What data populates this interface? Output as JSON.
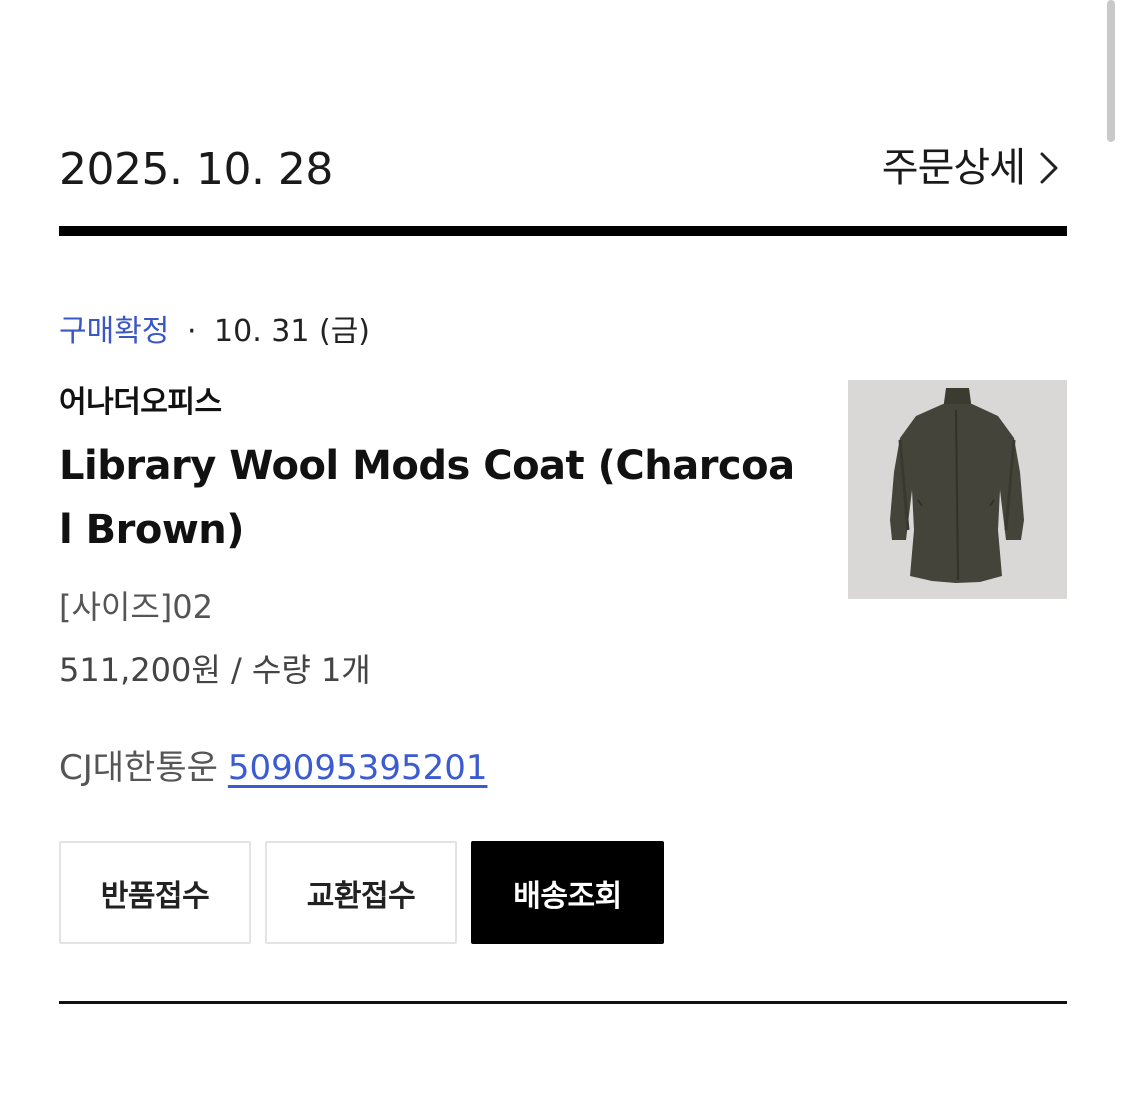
{
  "order": {
    "date": "2025. 10. 28",
    "detail_label": "주문상세"
  },
  "item": {
    "status_label": "구매확정",
    "status_separator": "·",
    "status_date": "10. 31 (금)",
    "brand": "어나더오피스",
    "product_name": "Library Wool Mods Coat (Charcoal Brown)",
    "option": "[사이즈]02",
    "price_quantity": "511,200원 / 수량 1개",
    "image_icon": "coat-product-image"
  },
  "shipping": {
    "carrier": "CJ대한통운",
    "tracking_number": "509095395201"
  },
  "actions": {
    "return_label": "반품접수",
    "exchange_label": "교환접수",
    "tracking_label": "배송조회"
  },
  "colors": {
    "status_accent": "#3b57c4",
    "link": "#3b5bd0",
    "primary_button": "#000000"
  }
}
